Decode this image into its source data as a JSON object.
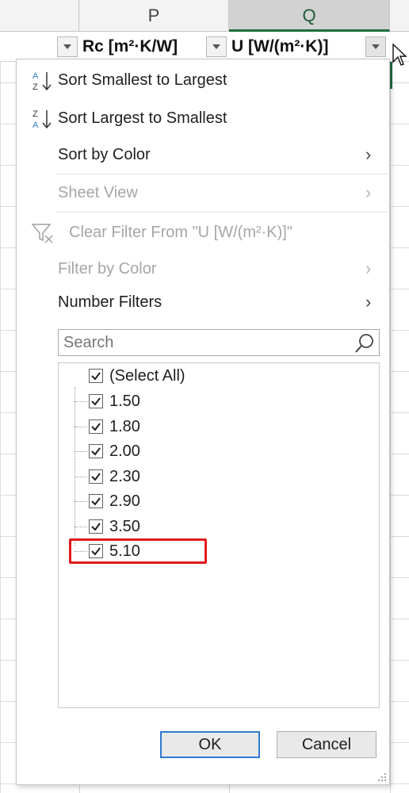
{
  "spreadsheet": {
    "columns": [
      {
        "letter": "P",
        "header": "Rc [m²·K/W]"
      },
      {
        "letter": "Q",
        "header": "U [W/(m²·K)]"
      }
    ]
  },
  "menu": {
    "sort_asc": "Sort Smallest to Largest",
    "sort_desc": "Sort Largest to Smallest",
    "sort_by_color": "Sort by Color",
    "sheet_view": "Sheet View",
    "clear_filter": "Clear Filter From \"U [W/(m²·K)]\"",
    "filter_by_color": "Filter by Color",
    "number_filters": "Number Filters"
  },
  "search": {
    "placeholder": "Search"
  },
  "values": [
    {
      "label": "(Select All)",
      "checked": true
    },
    {
      "label": "1.50",
      "checked": true
    },
    {
      "label": "1.80",
      "checked": true
    },
    {
      "label": "2.00",
      "checked": true
    },
    {
      "label": "2.30",
      "checked": true
    },
    {
      "label": "2.90",
      "checked": true
    },
    {
      "label": "3.50",
      "checked": true
    },
    {
      "label": "5.10",
      "checked": true
    }
  ],
  "buttons": {
    "ok": "OK",
    "cancel": "Cancel"
  },
  "colors": {
    "accent_green": "#1e6e3f",
    "highlight_red": "#e0191b",
    "ok_border": "#2f7ad1"
  },
  "icons": {
    "sort_asc": "sort-ascending-icon",
    "sort_desc": "sort-descending-icon",
    "clear_filter": "clear-filter-icon",
    "search": "search-icon",
    "submenu": "chevron-right-icon"
  }
}
